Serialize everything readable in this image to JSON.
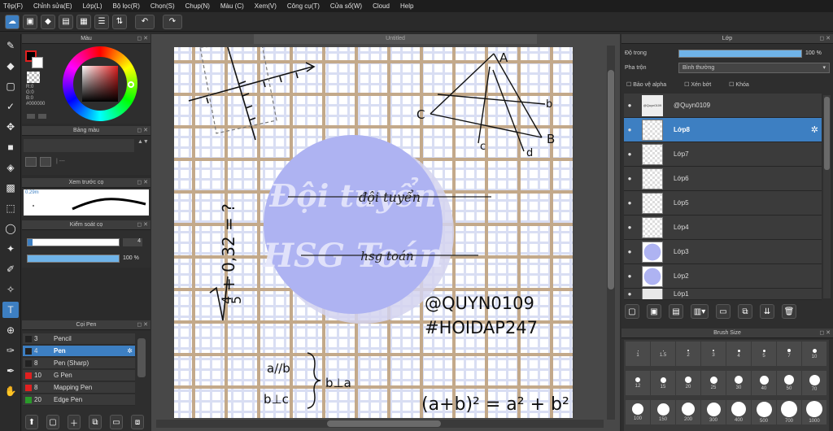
{
  "menu": [
    "Tệp(F)",
    "Chỉnh sửa(E)",
    "Lớp(L)",
    "Bộ lọc(R)",
    "Chọn(S)",
    "Chụp(N)",
    "Màu (C)",
    "Xem(V)",
    "Công cụ(T)",
    "Cửa sổ(W)",
    "Cloud",
    "Help"
  ],
  "color_panel": {
    "title": "Màu",
    "r": "R:0",
    "g": "G:0",
    "b": "B:0",
    "hex": "#000000"
  },
  "swatch_panel": {
    "title": "Bảng màu"
  },
  "brush_preview": {
    "title": "Xem trước cọ",
    "size": "0.29m"
  },
  "brush_control": {
    "title": "Kiểm soát cọ",
    "size": "4",
    "opacity": "100 %"
  },
  "pen_panel": {
    "title": "Cọi Pen",
    "items": [
      {
        "size": "3",
        "name": "Pencil",
        "color": "#222222"
      },
      {
        "size": "4",
        "name": "Pen",
        "color": "#222222"
      },
      {
        "size": "8",
        "name": "Pen (Sharp)",
        "color": "#222222"
      },
      {
        "size": "10",
        "name": "G Pen",
        "color": "#e02020"
      },
      {
        "size": "8",
        "name": "Mapping Pen",
        "color": "#e02020"
      },
      {
        "size": "20",
        "name": "Edge Pen",
        "color": "#2a9a2a"
      }
    ]
  },
  "document": {
    "title": "Untitled"
  },
  "layers_panel": {
    "title": "Lớp",
    "opacity_label": "Độ trong",
    "opacity_value": "100 %",
    "blend_label": "Pha trộn",
    "blend_value": "Bình thường",
    "protect_alpha": "Bảo vệ alpha",
    "clipping": "Xén bớt",
    "lock": "Khóa",
    "layers": [
      "@Quyn0109",
      "Lớp8",
      "Lớp7",
      "Lớp6",
      "Lớp5",
      "Lớp4",
      "Lớp3",
      "Lớp2",
      "Lớp1"
    ]
  },
  "brush_size": {
    "title": "Brush Size",
    "sizes": [
      "1",
      "1.5",
      "2",
      "3",
      "4",
      "5",
      "7",
      "10",
      "12",
      "15",
      "20",
      "25",
      "30",
      "40",
      "50",
      "70",
      "100",
      "150",
      "200",
      "300",
      "400",
      "500",
      "700",
      "1000"
    ]
  },
  "artwork": {
    "handle": "@QUYN0109",
    "tag": "#HOIDAP247",
    "banner1": "Đội tuyển",
    "banner2": "HSG Toán",
    "script1": "đội tuyển",
    "script2": "hsg toán",
    "expr": "+ 0,32 = ?",
    "frac_num": "4",
    "frac_den": "5",
    "par1": "a//b",
    "par2": "b⊥c",
    "perp": "b⊥a",
    "formula": "(a+b)² = a² + b²",
    "tri_A": "A",
    "tri_B": "B",
    "tri_C": "C",
    "tri_b": "b",
    "tri_c": "c",
    "tri_d": "d"
  }
}
